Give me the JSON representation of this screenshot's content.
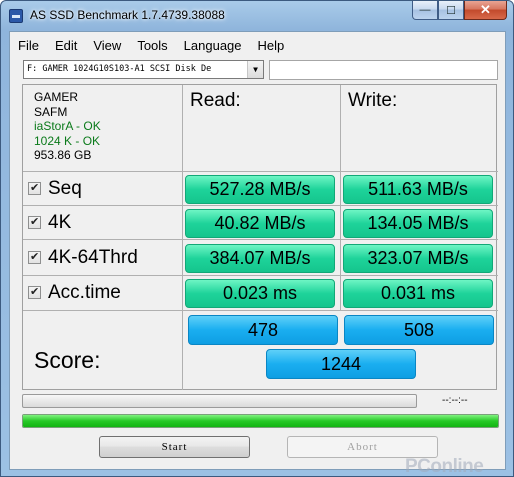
{
  "window": {
    "title": "AS SSD Benchmark 1.7.4739.38088",
    "minimize": "—",
    "maximize": "☐",
    "close": "✕"
  },
  "menu": [
    "File",
    "Edit",
    "View",
    "Tools",
    "Language",
    "Help"
  ],
  "drive": {
    "selected": "F: GAMER 1024G10S103-A1 SCSI Disk De",
    "arrow": "▼"
  },
  "info": {
    "name": "GAMER",
    "firmware": "SAFM",
    "driver": "iaStorA - OK",
    "alignment": "1024 K - OK",
    "capacity": "953.86 GB"
  },
  "headers": {
    "read": "Read:",
    "write": "Write:"
  },
  "tests": [
    {
      "label": "Seq",
      "checked": true,
      "read": "527.28 MB/s",
      "write": "511.63 MB/s"
    },
    {
      "label": "4K",
      "checked": true,
      "read": "40.82 MB/s",
      "write": "134.05 MB/s"
    },
    {
      "label": "4K-64Thrd",
      "checked": true,
      "read": "384.07 MB/s",
      "write": "323.07 MB/s"
    },
    {
      "label": "Acc.time",
      "checked": true,
      "read": "0.023 ms",
      "write": "0.031 ms"
    }
  ],
  "score": {
    "label": "Score:",
    "read": "478",
    "write": "508",
    "total": "1244"
  },
  "progress": {
    "elapsed": "--:--:--",
    "test_fraction": 0,
    "overall_fraction": 1
  },
  "buttons": {
    "start": "Start",
    "abort": "Abort"
  },
  "watermark": "PConline",
  "colors": {
    "result_green": "#1ed39a",
    "score_blue": "#1aaef0",
    "progress_green": "#27c927",
    "ok_text": "#0a7a1a"
  }
}
